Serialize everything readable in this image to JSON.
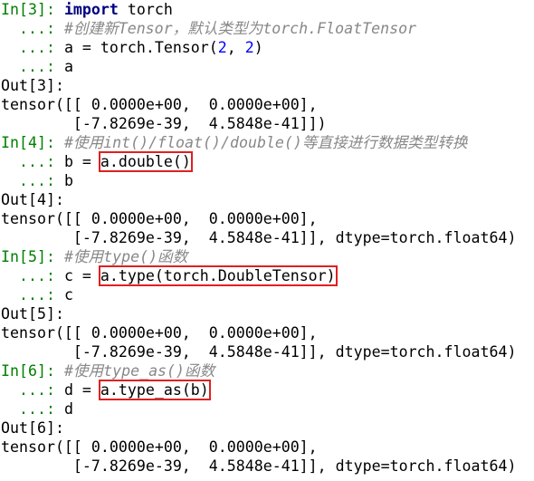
{
  "colors": {
    "prompt": "#008000",
    "keyword": "#000080",
    "number": "#0000ff",
    "comment": "#888888",
    "highlight_box": "#e02020"
  },
  "lines": [
    [
      {
        "t": "In[3]: ",
        "c": "prompt-in"
      },
      {
        "t": "import",
        "c": "kw"
      },
      {
        "t": " torch"
      }
    ],
    [
      {
        "t": "  ...: ",
        "c": "prompt-cont"
      },
      {
        "t": "#创建新Tensor，默认类型为torch.FloatTensor",
        "c": "comment"
      }
    ],
    [
      {
        "t": "  ...: ",
        "c": "prompt-cont"
      },
      {
        "t": "a = torch.Tensor("
      },
      {
        "t": "2",
        "c": "num"
      },
      {
        "t": ", "
      },
      {
        "t": "2",
        "c": "num"
      },
      {
        "t": ")"
      }
    ],
    [
      {
        "t": "  ...: ",
        "c": "prompt-cont"
      },
      {
        "t": "a"
      }
    ],
    [
      {
        "t": "Out[3]:",
        "c": "prompt-out"
      }
    ],
    [
      {
        "t": "tensor([[ 0.0000e+00,  0.0000e+00],"
      }
    ],
    [
      {
        "t": "        [-7.8269e-39,  4.5848e-41]])"
      }
    ],
    [
      {
        "t": "In[4]: ",
        "c": "prompt-in"
      },
      {
        "t": "#使用int()/float()/double()等直接进行数据类型转换",
        "c": "comment"
      }
    ],
    [
      {
        "t": "  ...: ",
        "c": "prompt-cont"
      },
      {
        "t": "b = "
      },
      {
        "t": "a.double()",
        "c": "box"
      }
    ],
    [
      {
        "t": "  ...: ",
        "c": "prompt-cont"
      },
      {
        "t": "b"
      }
    ],
    [
      {
        "t": "Out[4]:",
        "c": "prompt-out"
      }
    ],
    [
      {
        "t": "tensor([[ 0.0000e+00,  0.0000e+00],"
      }
    ],
    [
      {
        "t": "        [-7.8269e-39,  4.5848e-41]], dtype=torch.float64)"
      }
    ],
    [
      {
        "t": "In[5]: ",
        "c": "prompt-in"
      },
      {
        "t": "#使用type()函数",
        "c": "comment"
      }
    ],
    [
      {
        "t": "  ...: ",
        "c": "prompt-cont"
      },
      {
        "t": "c = "
      },
      {
        "t": "a.type(torch.DoubleTensor)",
        "c": "box"
      }
    ],
    [
      {
        "t": "  ...: ",
        "c": "prompt-cont"
      },
      {
        "t": "c"
      }
    ],
    [
      {
        "t": "Out[5]:",
        "c": "prompt-out"
      }
    ],
    [
      {
        "t": "tensor([[ 0.0000e+00,  0.0000e+00],"
      }
    ],
    [
      {
        "t": "        [-7.8269e-39,  4.5848e-41]], dtype=torch.float64)"
      }
    ],
    [
      {
        "t": "In[6]: ",
        "c": "prompt-in"
      },
      {
        "t": "#使用type_as()函数",
        "c": "comment"
      }
    ],
    [
      {
        "t": "  ...: ",
        "c": "prompt-cont"
      },
      {
        "t": "d = "
      },
      {
        "t": "a.type_as(b)",
        "c": "box"
      }
    ],
    [
      {
        "t": "  ...: ",
        "c": "prompt-cont"
      },
      {
        "t": "d"
      }
    ],
    [
      {
        "t": "Out[6]:",
        "c": "prompt-out"
      }
    ],
    [
      {
        "t": "tensor([[ 0.0000e+00,  0.0000e+00],"
      }
    ],
    [
      {
        "t": "        [-7.8269e-39,  4.5848e-41]], dtype=torch.float64)"
      }
    ]
  ]
}
